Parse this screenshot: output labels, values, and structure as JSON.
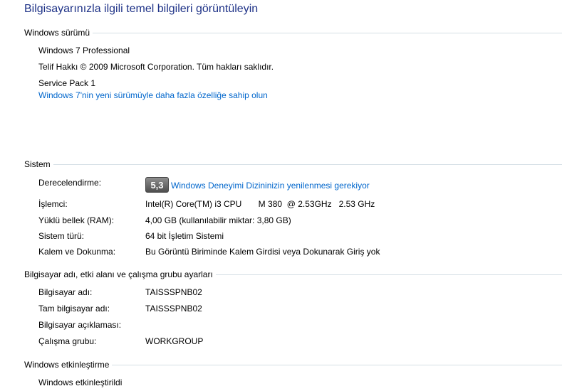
{
  "page": {
    "title": "Bilgisayarınızla ilgili temel bilgileri görüntüleyin"
  },
  "windows_edition": {
    "header": "Windows sürümü",
    "edition": "Windows 7 Professional",
    "copyright": "Telif Hakkı © 2009 Microsoft Corporation. Tüm hakları saklıdır.",
    "service_pack": "Service Pack 1",
    "upgrade_link": "Windows 7'nin yeni sürümüyle daha fazla özelliğe sahip olun"
  },
  "system": {
    "header": "Sistem",
    "rating_label": "Derecelendirme:",
    "rating_score": "5,3",
    "rating_link": "Windows Deneyimi Dizininizin yenilenmesi gerekiyor",
    "processor_label": "İşlemci:",
    "processor_value": "Intel(R) Core(TM) i3 CPU       M 380  @ 2.53GHz   2.53 GHz",
    "ram_label": "Yüklü bellek (RAM):",
    "ram_value": "4,00 GB (kullanılabilir miktar: 3,80 GB)",
    "type_label": "Sistem türü:",
    "type_value": "64 bit İşletim Sistemi",
    "pen_label": "Kalem ve Dokunma:",
    "pen_value": "Bu Görüntü Biriminde Kalem Girdisi veya Dokunarak Giriş yok"
  },
  "computer_name": {
    "header": "Bilgisayar adı, etki alanı ve çalışma grubu ayarları",
    "name_label": "Bilgisayar adı:",
    "name_value": "TAISSSPNB02",
    "full_name_label": "Tam bilgisayar adı:",
    "full_name_value": "TAISSSPNB02",
    "description_label": "Bilgisayar açıklaması:",
    "description_value": "",
    "workgroup_label": "Çalışma grubu:",
    "workgroup_value": "WORKGROUP"
  },
  "activation": {
    "header": "Windows etkinleştirme",
    "status": "Windows etkinleştirildi"
  },
  "colors": {
    "title": "#1e3287",
    "link": "#0066cc",
    "divider": "#d5dfe5"
  }
}
